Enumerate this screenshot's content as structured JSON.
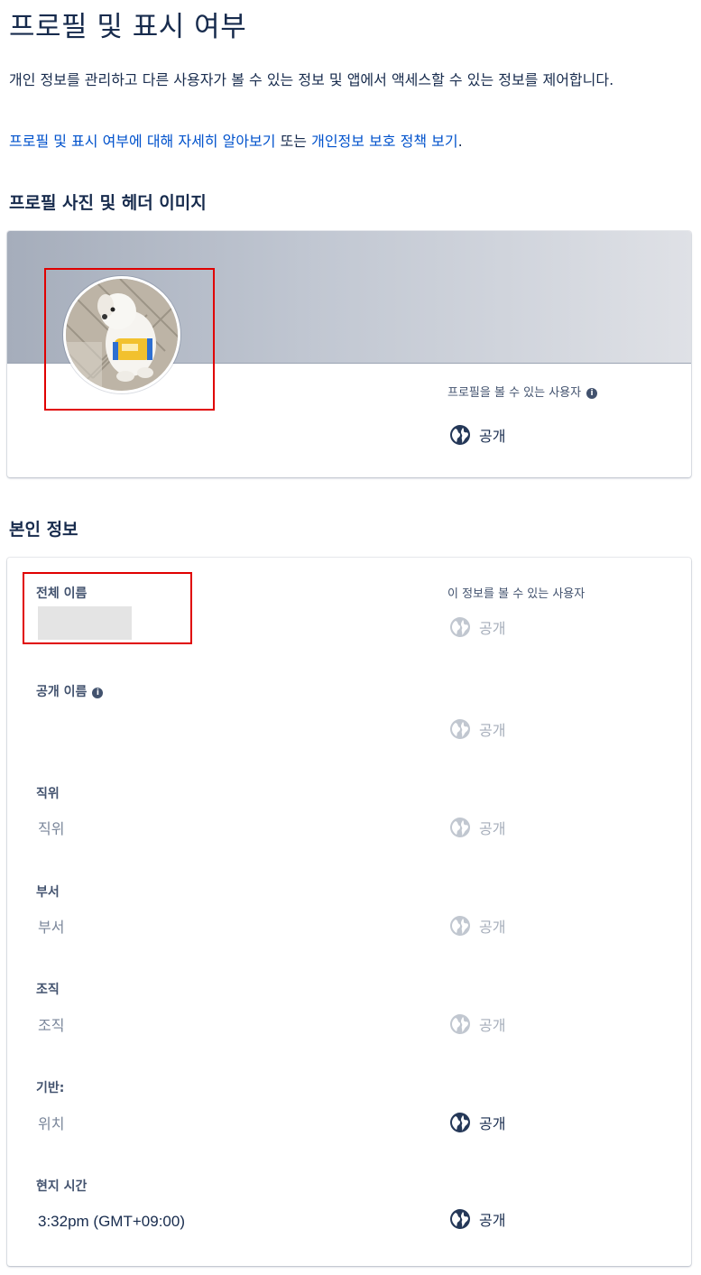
{
  "page": {
    "title": "프로필 및 표시 여부",
    "intro": "개인 정보를 관리하고 다른 사용자가 볼 수 있는 정보 및 앱에서 액세스할 수 있는 정보를 제어합니다.",
    "learn_more_link": "프로필 및 표시 여부에 대해 자세히 알아보기",
    "connector": " 또는 ",
    "privacy_link": "개인정보 보호 정책 보기",
    "period": "."
  },
  "profile_photo_section": {
    "title": "프로필 사진 및 헤더 이미지",
    "visibility_label": "프로필을 볼 수 있는 사용자",
    "visibility_value": "공개"
  },
  "about_section": {
    "title": "본인 정보",
    "visibility_label": "이 정보를 볼 수 있는 사용자",
    "fields": [
      {
        "label": "전체 이름",
        "value": "",
        "visibility": "공개"
      },
      {
        "label": "공개 이름",
        "value": "",
        "visibility": "공개"
      },
      {
        "label": "직위",
        "value": "직위",
        "visibility": "공개"
      },
      {
        "label": "부서",
        "value": "부서",
        "visibility": "공개"
      },
      {
        "label": "조직",
        "value": "조직",
        "visibility": "공개"
      },
      {
        "label": "기반:",
        "value": "위치",
        "visibility": "공개"
      },
      {
        "label": "현지 시간",
        "value": "3:32pm (GMT+09:00)",
        "visibility": "공개"
      }
    ]
  },
  "icons": {
    "info": "info-icon",
    "globe": "globe-icon",
    "avatar": "dog-avatar-photo"
  },
  "colors": {
    "link": "#0052cc",
    "text": "#172b4d",
    "muted": "#a5adba",
    "highlight_frame": "#e00000"
  }
}
